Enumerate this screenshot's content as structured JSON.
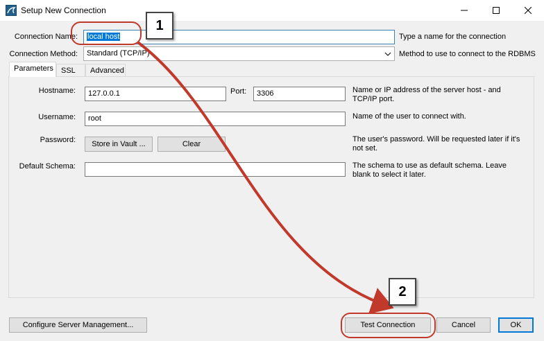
{
  "window": {
    "title": "Setup New Connection"
  },
  "form": {
    "connection_name_label": "Connection Name:",
    "connection_name_value": "local host",
    "connection_name_help": "Type a name for the connection",
    "connection_method_label": "Connection Method:",
    "connection_method_value": "Standard (TCP/IP)",
    "connection_method_help": "Method to use to connect to the RDBMS"
  },
  "tabs": [
    {
      "label": "Parameters",
      "active": true
    },
    {
      "label": "SSL",
      "active": false
    },
    {
      "label": "Advanced",
      "active": false
    }
  ],
  "parameters": {
    "hostname_label": "Hostname:",
    "hostname_value": "127.0.0.1",
    "port_label": "Port:",
    "port_value": "3306",
    "hostname_help_line1": "Name or IP address of the server host - and",
    "hostname_help_line2": "TCP/IP port.",
    "username_label": "Username:",
    "username_value": "root",
    "username_help": "Name of the user to connect with.",
    "password_label": "Password:",
    "store_in_vault_label": "Store in Vault ...",
    "clear_label": "Clear",
    "password_help_line1": "The user's password. Will be requested later if it's",
    "password_help_line2": "not set.",
    "default_schema_label": "Default Schema:",
    "default_schema_value": "",
    "default_schema_help_line1": "The schema to use as default schema. Leave",
    "default_schema_help_line2": "blank to select it later."
  },
  "footer": {
    "configure_label": "Configure Server Management...",
    "test_connection_label": "Test Connection",
    "cancel_label": "Cancel",
    "ok_label": "OK"
  },
  "annotations": {
    "step1": "1",
    "step2": "2",
    "color": "#c0392b"
  },
  "icons": [
    "mysql-workbench-app-icon",
    "minimize-icon",
    "maximize-icon",
    "close-icon",
    "chevron-down-icon"
  ]
}
